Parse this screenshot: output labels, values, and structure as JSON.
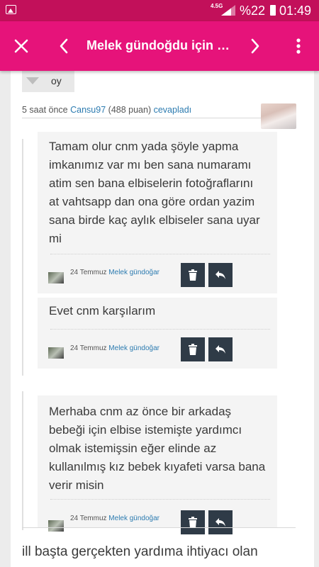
{
  "status_bar": {
    "network": "4.5G",
    "battery": "%22",
    "time": "01:49"
  },
  "app_bar": {
    "title": "Melek gündoğdu için ara..."
  },
  "question": {
    "vote_label": "oy",
    "meta": {
      "time": "5 saat önce",
      "user": "Cansu97",
      "points": "(488 puan)",
      "action": "cevapladı"
    }
  },
  "comments": [
    {
      "text": "Tamam olur cnm yada şöyle yapma imkanımız var mı ben sana numaramı atim sen bana elbiselerin fotoğraflarını at vahtsapp dan ona göre ordan yazim sana birde kaç aylık elbiseler sana uyar mi",
      "date": "24 Temmuz",
      "author": "Melek gündoğar"
    },
    {
      "text": "Evet cnm karşılarım",
      "date": "24 Temmuz",
      "author": "Melek gündoğar"
    },
    {
      "text": "Merhaba cnm az önce bir arkadaş bebeği için elbise istemişte yardımcı olmak istemişsin eğer elinde az kullanılmış kız bebek kıyafeti varsa bana verir misin",
      "date": "24 Temmuz",
      "author": "Melek gündoğar"
    }
  ],
  "bottom_text": "ill başta gerçekten yardıma ihtiyacı olan",
  "colors": {
    "status_bar": "#c2105a",
    "app_bar": "#e6137a",
    "link": "#2c7bb0",
    "icon_button": "#2f3b47"
  },
  "icons": [
    "image-icon",
    "signal-icon",
    "battery-icon",
    "close-icon",
    "chevron-left-icon",
    "chevron-right-icon",
    "more-vert-icon",
    "vote-down-icon",
    "trash-icon",
    "reply-icon"
  ]
}
